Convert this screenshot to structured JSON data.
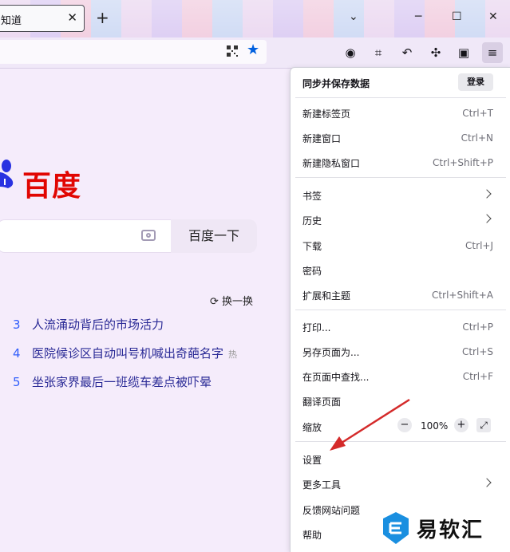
{
  "tab": {
    "title": "知道",
    "close": "✕"
  },
  "window": {
    "new_tab": "+",
    "list_tabs": "⌄",
    "minimize": "─",
    "maximize": "☐",
    "close": "✕"
  },
  "page": {
    "logo_text": "百度",
    "search_button": "百度一下",
    "refresh_label": "换一换",
    "hot_items": [
      {
        "num": "3",
        "text": "人流涌动背后的市场活力",
        "badge": ""
      },
      {
        "num": "4",
        "text": "医院候诊区自动叫号机喊出奇葩名字",
        "badge": "热"
      },
      {
        "num": "5",
        "text": "坐张家界最后一班缆车差点被吓晕",
        "badge": ""
      }
    ]
  },
  "menu": {
    "header_title": "同步并保存数据",
    "login_label": "登录",
    "items": [
      {
        "label": "新建标签页",
        "shortcut": "Ctrl+T"
      },
      {
        "label": "新建窗口",
        "shortcut": "Ctrl+N"
      },
      {
        "label": "新建隐私窗口",
        "shortcut": "Ctrl+Shift+P"
      },
      {
        "label": "书签",
        "shortcut": ""
      },
      {
        "label": "历史",
        "shortcut": ""
      },
      {
        "label": "下载",
        "shortcut": "Ctrl+J"
      },
      {
        "label": "密码",
        "shortcut": ""
      },
      {
        "label": "扩展和主题",
        "shortcut": "Ctrl+Shift+A"
      },
      {
        "label": "打印...",
        "shortcut": "Ctrl+P"
      },
      {
        "label": "另存页面为...",
        "shortcut": "Ctrl+S"
      },
      {
        "label": "在页面中查找...",
        "shortcut": "Ctrl+F"
      },
      {
        "label": "翻译页面",
        "shortcut": ""
      },
      {
        "label": "缩放",
        "shortcut": ""
      },
      {
        "label": "设置",
        "shortcut": ""
      },
      {
        "label": "更多工具",
        "shortcut": ""
      },
      {
        "label": "反馈网站问题",
        "shortcut": ""
      },
      {
        "label": "帮助",
        "shortcut": ""
      }
    ],
    "zoom": {
      "minus": "−",
      "value": "100%",
      "plus": "+",
      "fullscreen": "⤢"
    }
  },
  "watermark": {
    "text": "易软汇"
  },
  "colors": {
    "accent": "#0060df",
    "baidu_red": "#e10602",
    "hot_num": "#315efb",
    "annotation": "#d42a2a"
  }
}
